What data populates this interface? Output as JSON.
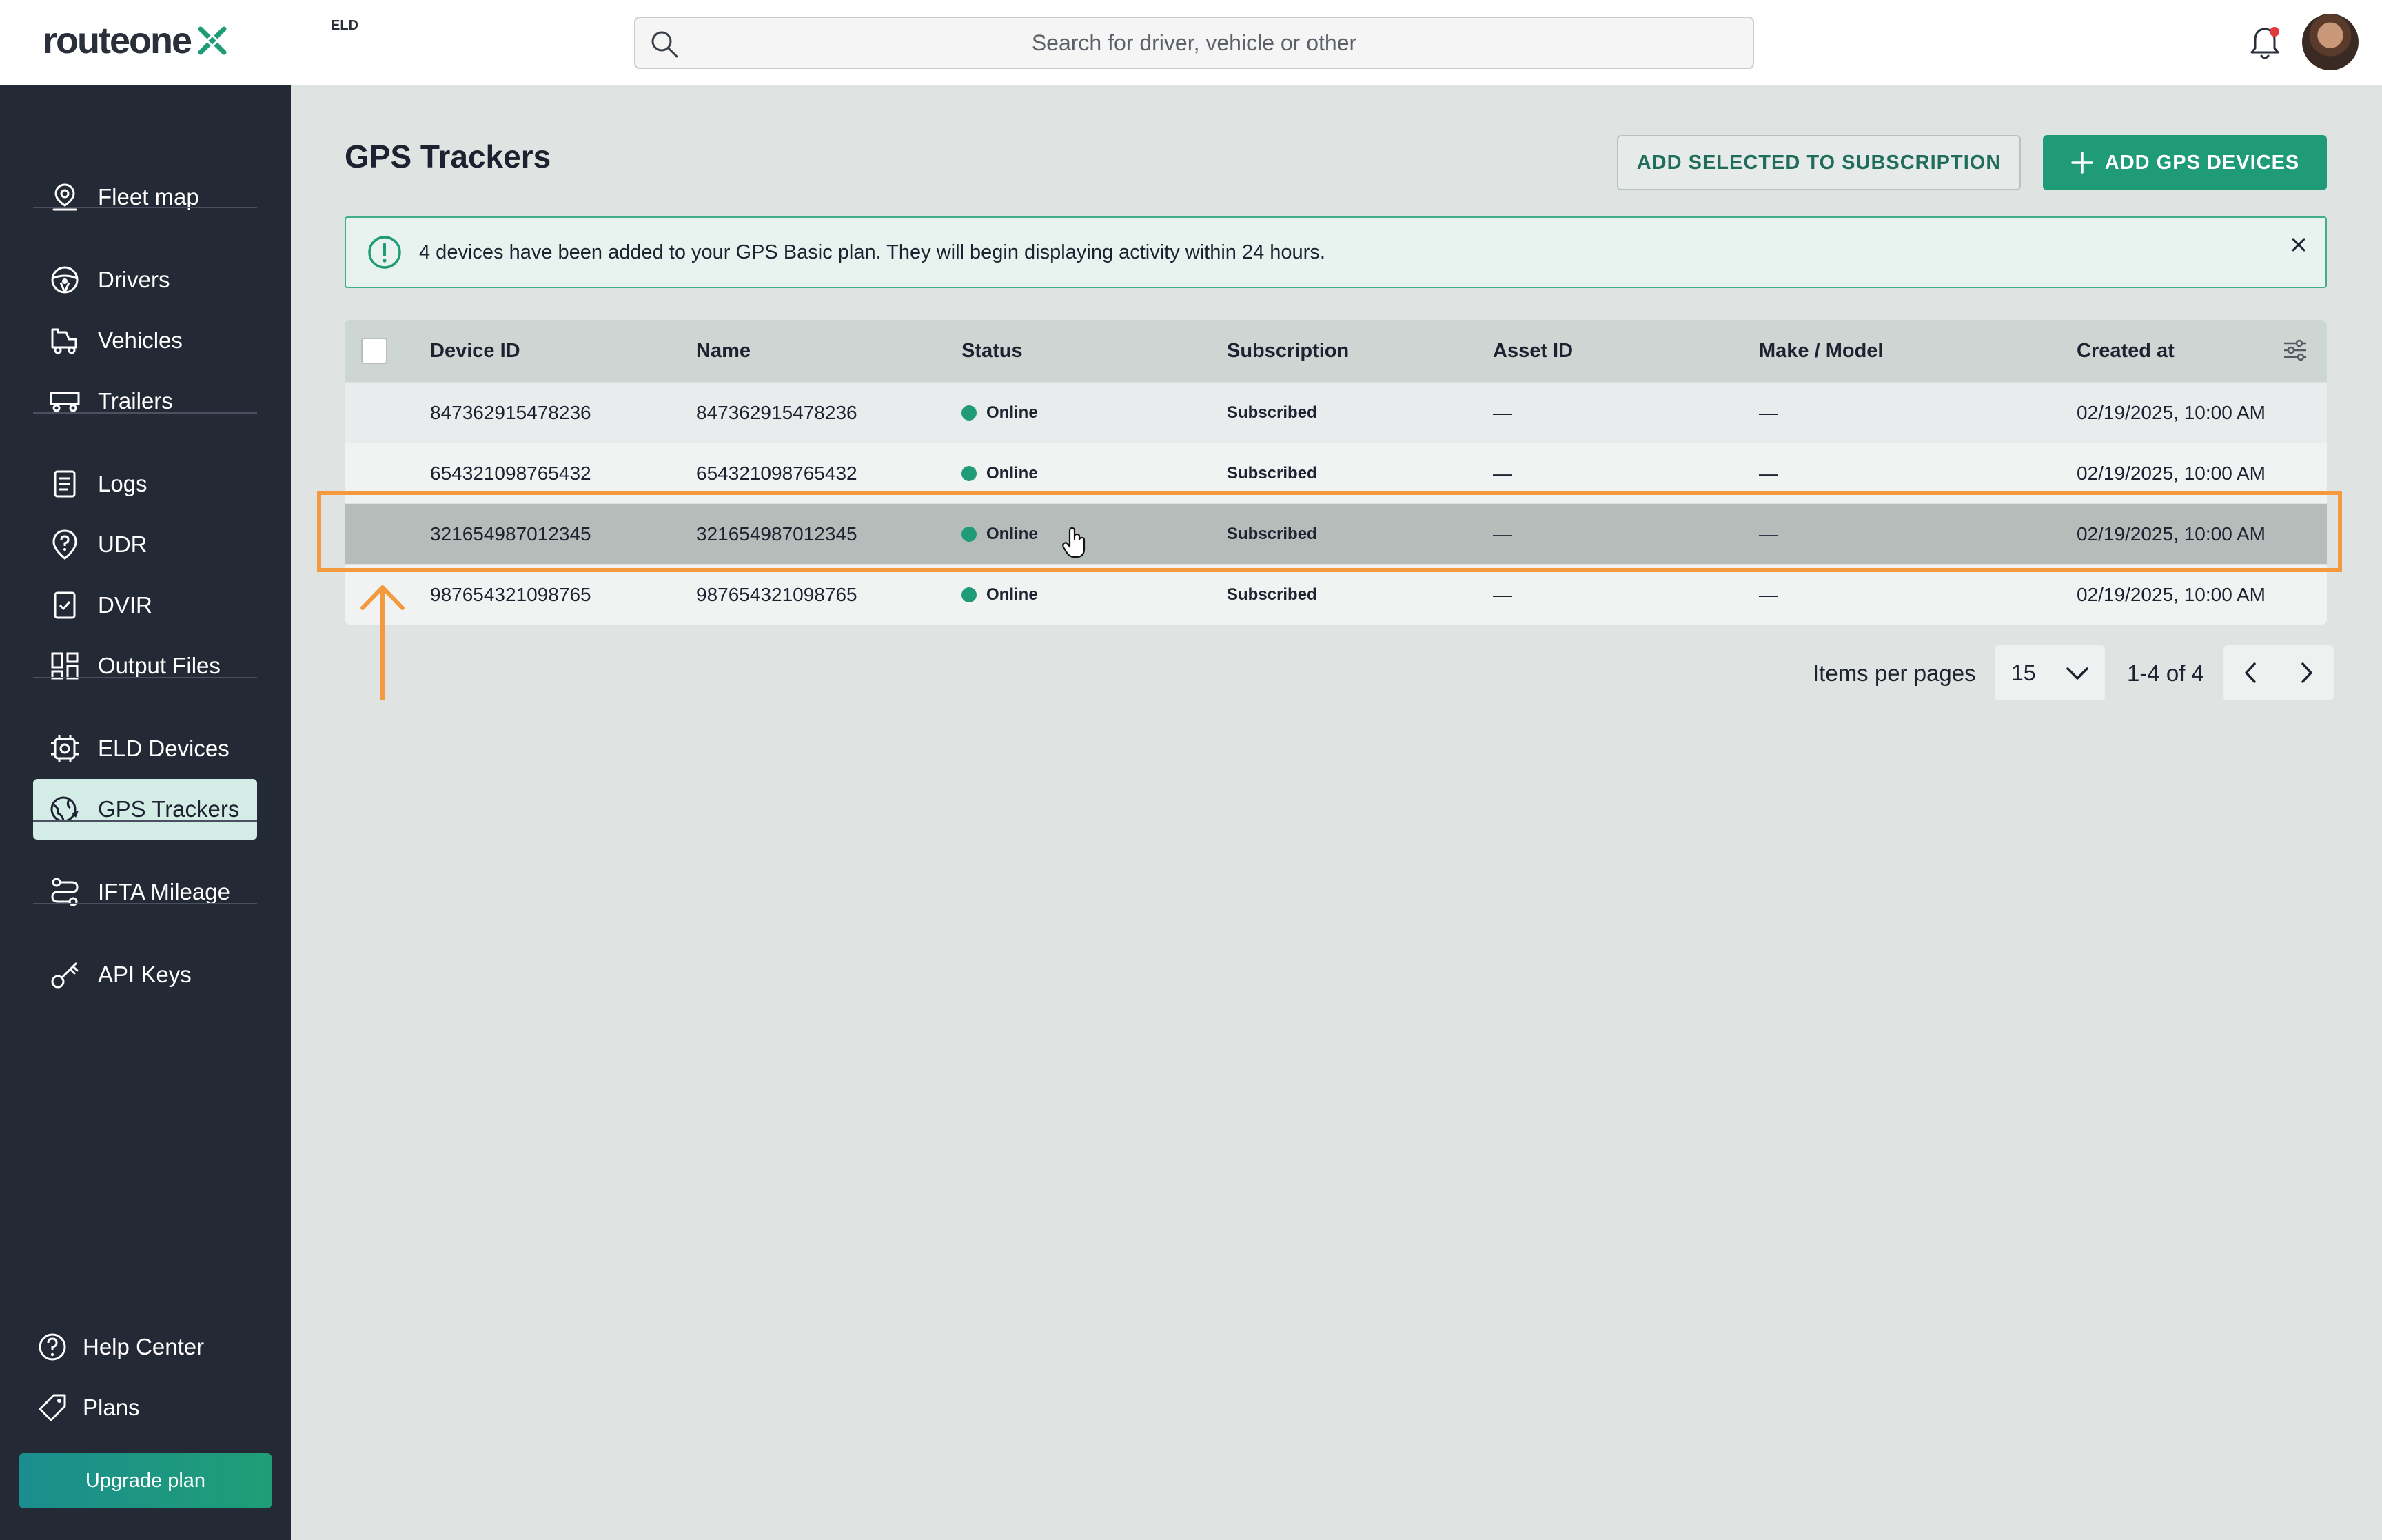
{
  "brand": {
    "name": "routeone",
    "badge": "ELD"
  },
  "search": {
    "placeholder": "Search for driver, vehicle or other"
  },
  "sidebar": {
    "items": [
      {
        "label": "Fleet map",
        "icon": "map-pin-icon"
      },
      {
        "label": "Drivers",
        "icon": "steering-wheel-icon"
      },
      {
        "label": "Vehicles",
        "icon": "truck-icon"
      },
      {
        "label": "Trailers",
        "icon": "trailer-icon"
      },
      {
        "label": "Logs",
        "icon": "clipboard-icon"
      },
      {
        "label": "UDR",
        "icon": "question-badge-icon"
      },
      {
        "label": "DVIR",
        "icon": "checklist-icon"
      },
      {
        "label": "Output Files",
        "icon": "grid-files-icon"
      },
      {
        "label": "ELD Devices",
        "icon": "chip-icon"
      },
      {
        "label": "GPS Trackers",
        "icon": "gps-tracker-icon",
        "active": true
      },
      {
        "label": "IFTA Mileage",
        "icon": "route-icon"
      },
      {
        "label": "API Keys",
        "icon": "key-icon"
      }
    ],
    "footer": [
      {
        "label": "Help Center",
        "icon": "help-circle-icon"
      },
      {
        "label": "Plans",
        "icon": "tag-icon"
      }
    ],
    "upgrade_label": "Upgrade plan"
  },
  "page": {
    "title": "GPS Trackers",
    "add_selected_label": "ADD SELECTED TO SUBSCRIPTION",
    "add_devices_label": "ADD GPS DEVICES"
  },
  "alert": {
    "message": "4 devices have been added to your GPS Basic plan. They will begin displaying activity within 24 hours."
  },
  "table": {
    "columns": [
      "Device ID",
      "Name",
      "Status",
      "Subscription",
      "Asset ID",
      "Make / Model",
      "Created at"
    ],
    "rows": [
      {
        "device_id": "847362915478236",
        "name": "847362915478236",
        "status": "Online",
        "subscription": "Subscribed",
        "asset_id": "—",
        "make_model": "—",
        "created_at": "02/19/2025, 10:00 AM"
      },
      {
        "device_id": "654321098765432",
        "name": "654321098765432",
        "status": "Online",
        "subscription": "Subscribed",
        "asset_id": "—",
        "make_model": "—",
        "created_at": "02/19/2025, 10:00 AM"
      },
      {
        "device_id": "321654987012345",
        "name": "321654987012345",
        "status": "Online",
        "subscription": "Subscribed",
        "asset_id": "—",
        "make_model": "—",
        "created_at": "02/19/2025, 10:00 AM",
        "highlighted": true
      },
      {
        "device_id": "987654321098765",
        "name": "987654321098765",
        "status": "Online",
        "subscription": "Subscribed",
        "asset_id": "—",
        "make_model": "—",
        "created_at": "02/19/2025, 10:00 AM"
      }
    ]
  },
  "pagination": {
    "label": "Items per pages",
    "per_page": "15",
    "range": "1-4 of 4"
  },
  "colors": {
    "accent": "#1f9b78",
    "sidebar_bg": "#242936",
    "annotation": "#f39a3e",
    "notification_dot": "#e23b3b"
  }
}
